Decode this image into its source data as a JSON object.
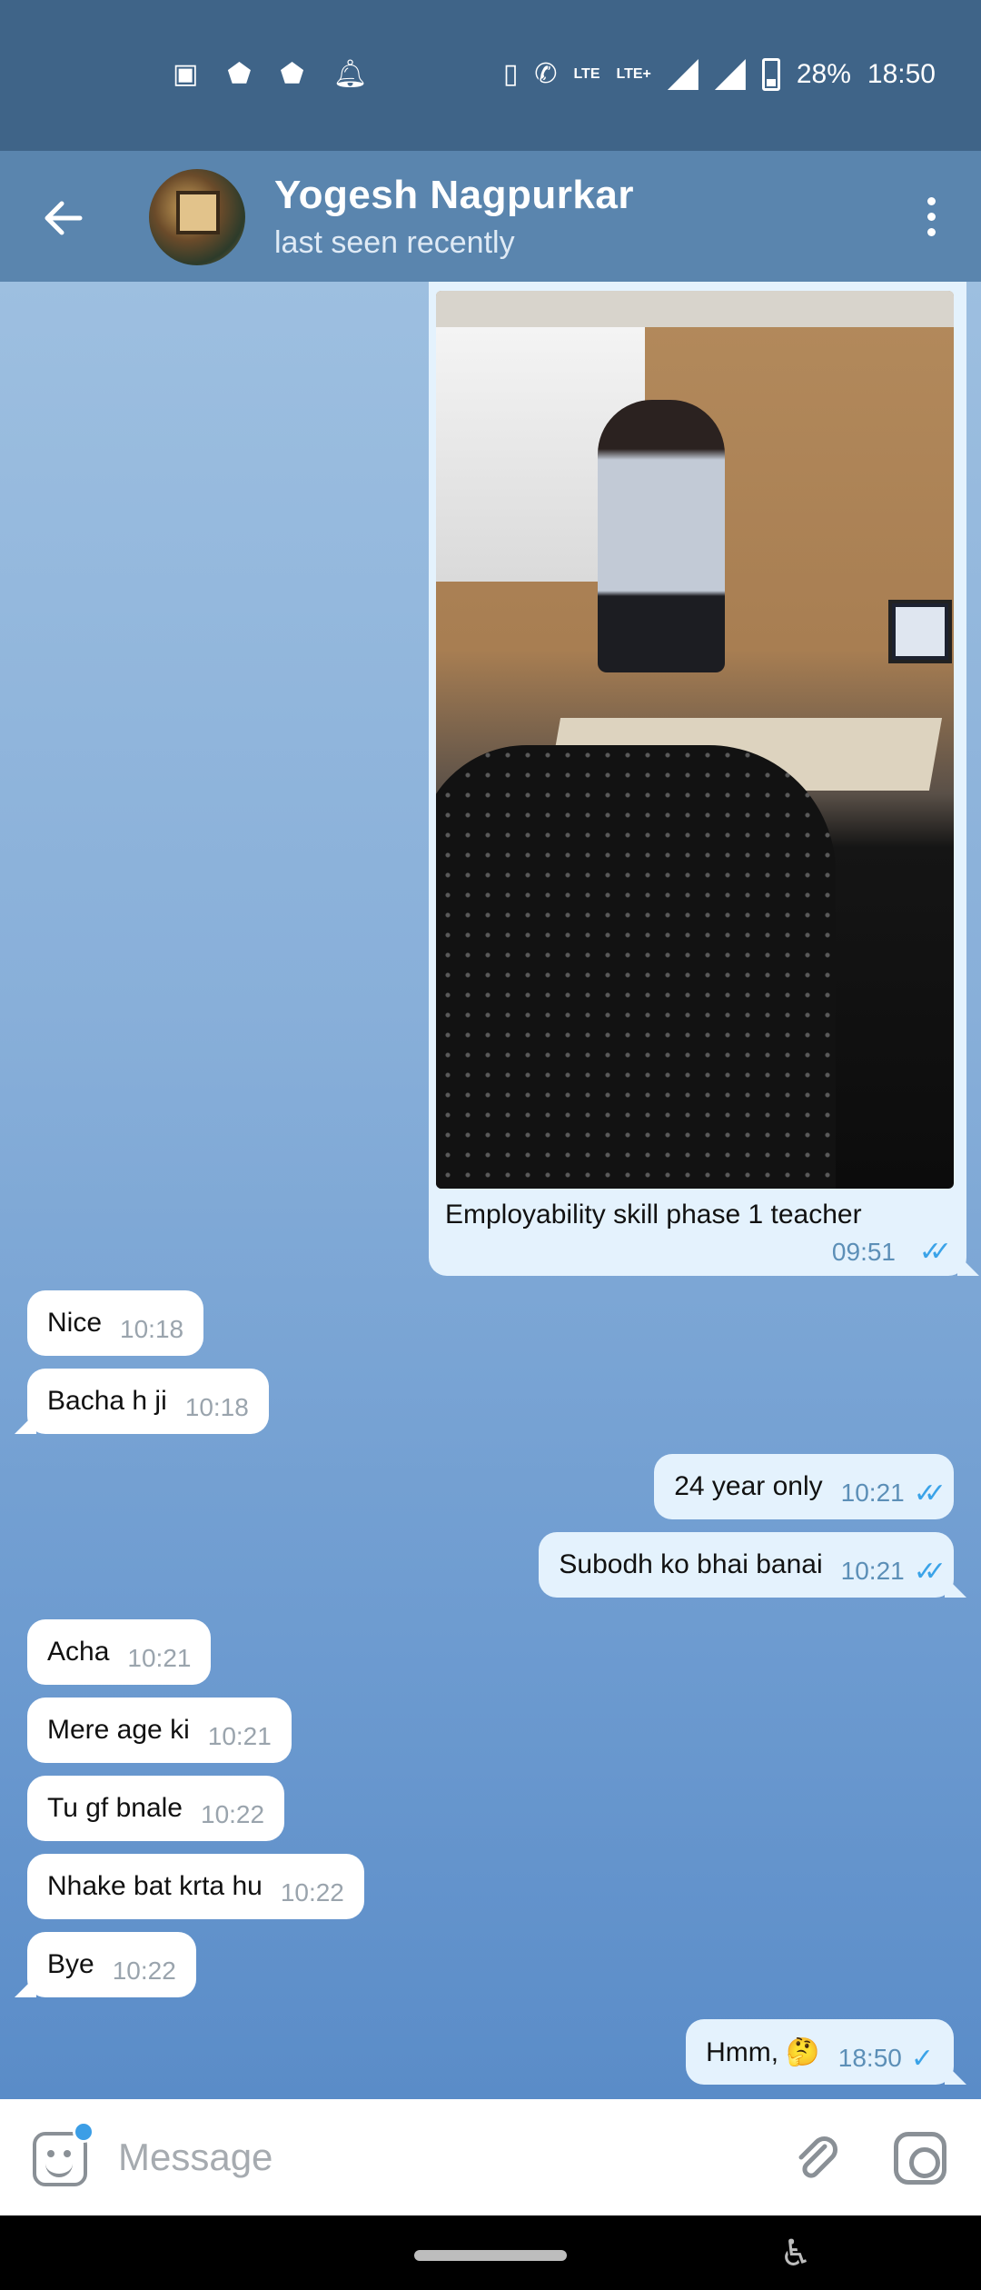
{
  "status_bar": {
    "network_left": "LTE",
    "network_right": "LTE+",
    "battery": "28%",
    "time": "18:50"
  },
  "header": {
    "contact_name": "Yogesh Nagpurkar",
    "status": "last seen recently"
  },
  "messages": {
    "photo": {
      "caption": "Employability skill phase 1 teacher",
      "time": "09:51"
    },
    "m1": {
      "text": "Nice",
      "time": "10:18"
    },
    "m2": {
      "text": "Bacha h ji",
      "time": "10:18"
    },
    "m3": {
      "text": "24 year only",
      "time": "10:21"
    },
    "m4": {
      "text": "Subodh ko bhai banai",
      "time": "10:21"
    },
    "m5": {
      "text": "Acha",
      "time": "10:21"
    },
    "m6": {
      "text": "Mere age ki",
      "time": "10:21"
    },
    "m7": {
      "text": "Tu gf bnale",
      "time": "10:22"
    },
    "m8": {
      "text": "Nhake bat krta hu",
      "time": "10:22"
    },
    "m9": {
      "text": "Bye",
      "time": "10:22"
    },
    "m10": {
      "text": "Hmm, 🤔",
      "time": "18:50"
    }
  },
  "input": {
    "placeholder": "Message"
  },
  "colors": {
    "header": "#5a85ae",
    "status_bar": "#3f6488",
    "outgoing_bubble": "#e4f2fd",
    "incoming_bubble": "#ffffff",
    "tick": "#3aa3e8"
  }
}
